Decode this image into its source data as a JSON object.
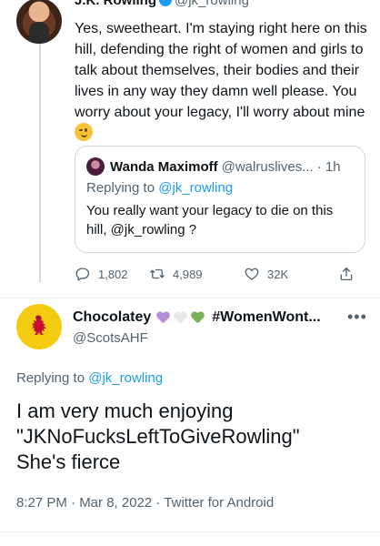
{
  "parent_tweet": {
    "author_name": "J.K. Rowling",
    "author_handle": "@jk_rowling",
    "text": "Yes, sweetheart. I'm staying right here on this hill, defending the right of women and girls to talk about themselves, their bodies and their lives in any way they damn well please. You worry about your legacy, I'll worry about mine",
    "emoji": "winking-face"
  },
  "quoted_tweet": {
    "author_name": "Wanda Maximoff",
    "author_handle": "@walruslives...",
    "time": "· 1h",
    "replying_prefix": "Replying to",
    "replying_to": "@jk_rowling",
    "text": "You really want your legacy to die on this hill, @jk_rowling ?"
  },
  "parent_actions": {
    "replies": "1,802",
    "retweets": "4,989",
    "likes": "32K"
  },
  "main_tweet": {
    "author_name": "Chocolatey",
    "name_suffix": "#WomenWont...",
    "name_hearts": [
      "#b58fd6",
      "#f2f2f2",
      "#78b159"
    ],
    "author_handle": "@ScotsAHF",
    "replying_prefix": "Replying to",
    "replying_to": "@jk_rowling",
    "text": "I am very much enjoying\n\"JKNoFucksLeftToGiveRowling\"\nShe's fierce",
    "timestamp": "8:27 PM · Mar 8, 2022 · Twitter for Android"
  },
  "colors": {
    "link": "#1d9bf0",
    "secondary_text": "#536471",
    "border": "#cfd9de"
  }
}
